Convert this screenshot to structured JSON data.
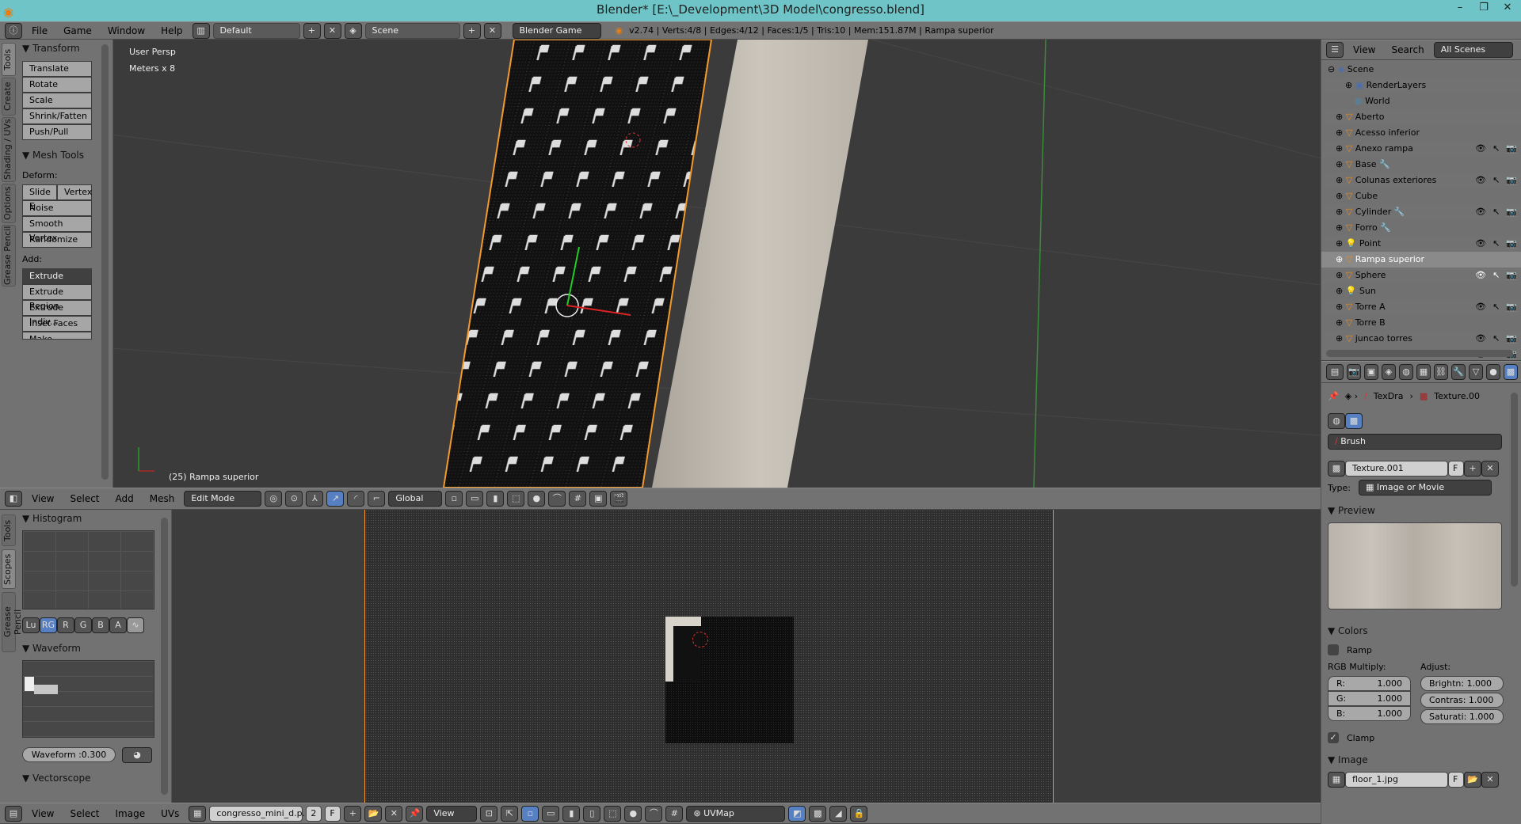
{
  "window": {
    "title": "Blender* [E:\\_Development\\3D Model\\congresso.blend]",
    "minimize": "–",
    "maximize": "❐",
    "close": "✕"
  },
  "info_header": {
    "menus": [
      "File",
      "Game",
      "Window",
      "Help"
    ],
    "layout": "Default",
    "scene": "Scene",
    "engine": "Blender Game",
    "stats": "v2.74 | Verts:4/8 | Edges:4/12 | Faces:1/5 | Tris:10 | Mem:151.87M | Rampa superior"
  },
  "viewport": {
    "view_name": "User Persp",
    "scale": "Meters x 8",
    "object_label": "(25) Rampa superior"
  },
  "tool_shelf": {
    "tabs": [
      "Tools",
      "Create",
      "Shading / UVs",
      "Options",
      "Grease Pencil"
    ],
    "transform_title": "Transform",
    "transform_buttons": [
      "Translate",
      "Rotate",
      "Scale",
      "Shrink/Fatten",
      "Push/Pull"
    ],
    "mesh_tools_title": "Mesh Tools",
    "deform_label": "Deform:",
    "slide_edge": "Slide E",
    "vertex": "Vertex",
    "deform_buttons": [
      "Noise",
      "Smooth Vertex",
      "Randomize"
    ],
    "add_label": "Add:",
    "extrude": "Extrude",
    "add_buttons": [
      "Extrude Region",
      "Extrude Indiv...",
      "Inset Faces",
      "Make Edge/F..."
    ]
  },
  "view3d_header": {
    "menus": [
      "View",
      "Select",
      "Add",
      "Mesh"
    ],
    "mode": "Edit Mode",
    "orientation": "Global"
  },
  "outliner": {
    "menus": [
      "View",
      "Search"
    ],
    "filter": "All Scenes",
    "scene": "Scene",
    "render_layers": "RenderLayers",
    "world": "World",
    "objects": [
      {
        "name": "Aberto",
        "type": "mesh"
      },
      {
        "name": "Acesso inferior",
        "type": "mesh"
      },
      {
        "name": "Anexo rampa",
        "type": "mesh"
      },
      {
        "name": "Base",
        "type": "mesh",
        "modifier": true
      },
      {
        "name": "Colunas exteriores",
        "type": "mesh",
        "hidden": true
      },
      {
        "name": "Cube",
        "type": "mesh"
      },
      {
        "name": "Cylinder",
        "type": "mesh",
        "modifier": true
      },
      {
        "name": "Forro",
        "type": "mesh",
        "modifier": true
      },
      {
        "name": "Point",
        "type": "lamp"
      },
      {
        "name": "Rampa superior",
        "type": "mesh",
        "active": true
      },
      {
        "name": "Sphere",
        "type": "mesh"
      },
      {
        "name": "Sun",
        "type": "lamp"
      },
      {
        "name": "Torre A",
        "type": "mesh"
      },
      {
        "name": "Torre B",
        "type": "mesh"
      },
      {
        "name": "juncao torres",
        "type": "mesh"
      }
    ]
  },
  "properties": {
    "breadcrumb": [
      "TexDra",
      "Texture.00"
    ],
    "brush": "Brush",
    "texture_name": "Texture.001",
    "fake_user": "F",
    "type_label": "Type:",
    "type_value": "Image or Movie",
    "preview_title": "Preview",
    "colors_title": "Colors",
    "ramp": "Ramp",
    "ramp_checked": false,
    "rgb_label": "RGB Multiply:",
    "adjust_label": "Adjust:",
    "r": {
      "label": "R:",
      "value": "1.000"
    },
    "g": {
      "label": "G:",
      "value": "1.000"
    },
    "b": {
      "label": "B:",
      "value": "1.000"
    },
    "brightness": "Brightn: 1.000",
    "contrast": "Contras: 1.000",
    "saturation": "Saturati: 1.000",
    "clamp": "Clamp",
    "clamp_checked": true,
    "image_title": "Image",
    "image_name": "floor_1.jpg",
    "image_f": "F"
  },
  "scopes": {
    "tabs": [
      "Tools",
      "Scopes",
      "Grease Pencil"
    ],
    "histogram_title": "Histogram",
    "channels": [
      "Lu",
      "RG",
      "R",
      "G",
      "B",
      "A"
    ],
    "active_channel": "RG",
    "waveform_title": "Waveform",
    "waveform_opacity": "Waveform :0.300",
    "vectorscope_title": "Vectorscope"
  },
  "uv_header": {
    "menus": [
      "View",
      "Select",
      "Image",
      "UVs"
    ],
    "image": "congresso_mini_d.p...",
    "users": "2",
    "f": "F",
    "view": "View",
    "uvmap": "UVMap"
  },
  "colors": {
    "accent": "#5680c2",
    "selected_orange": "#f39a2c",
    "title_bar": "#6ec4c6"
  }
}
